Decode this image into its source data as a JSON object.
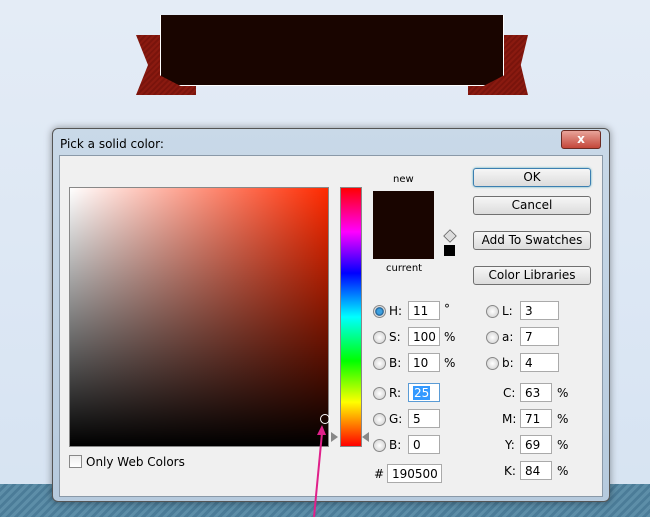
{
  "dialog": {
    "title": "Pick a solid color:",
    "close": "x"
  },
  "swatch": {
    "new_label": "new",
    "current_label": "current",
    "new_color": "#190500",
    "current_color": "#190500"
  },
  "buttons": {
    "ok": "OK",
    "cancel": "Cancel",
    "add": "Add To Swatches",
    "libraries": "Color Libraries"
  },
  "hsb": [
    {
      "label": "H:",
      "value": "11",
      "unit": "°",
      "selected": true
    },
    {
      "label": "S:",
      "value": "100",
      "unit": "%"
    },
    {
      "label": "B:",
      "value": "10",
      "unit": "%"
    }
  ],
  "rgb": [
    {
      "label": "R:",
      "value": "25"
    },
    {
      "label": "G:",
      "value": "5"
    },
    {
      "label": "B:",
      "value": "0"
    }
  ],
  "lab": [
    {
      "label": "L:",
      "value": "3"
    },
    {
      "label": "a:",
      "value": "7"
    },
    {
      "label": "b:",
      "value": "4"
    }
  ],
  "cmyk": [
    {
      "label": "C:",
      "value": "63",
      "unit": "%"
    },
    {
      "label": "M:",
      "value": "71",
      "unit": "%"
    },
    {
      "label": "Y:",
      "value": "69",
      "unit": "%"
    },
    {
      "label": "K:",
      "value": "84",
      "unit": "%"
    }
  ],
  "hex": {
    "label": "#",
    "value": "190500"
  },
  "web_only": {
    "label": "Only Web Colors",
    "checked": false
  }
}
